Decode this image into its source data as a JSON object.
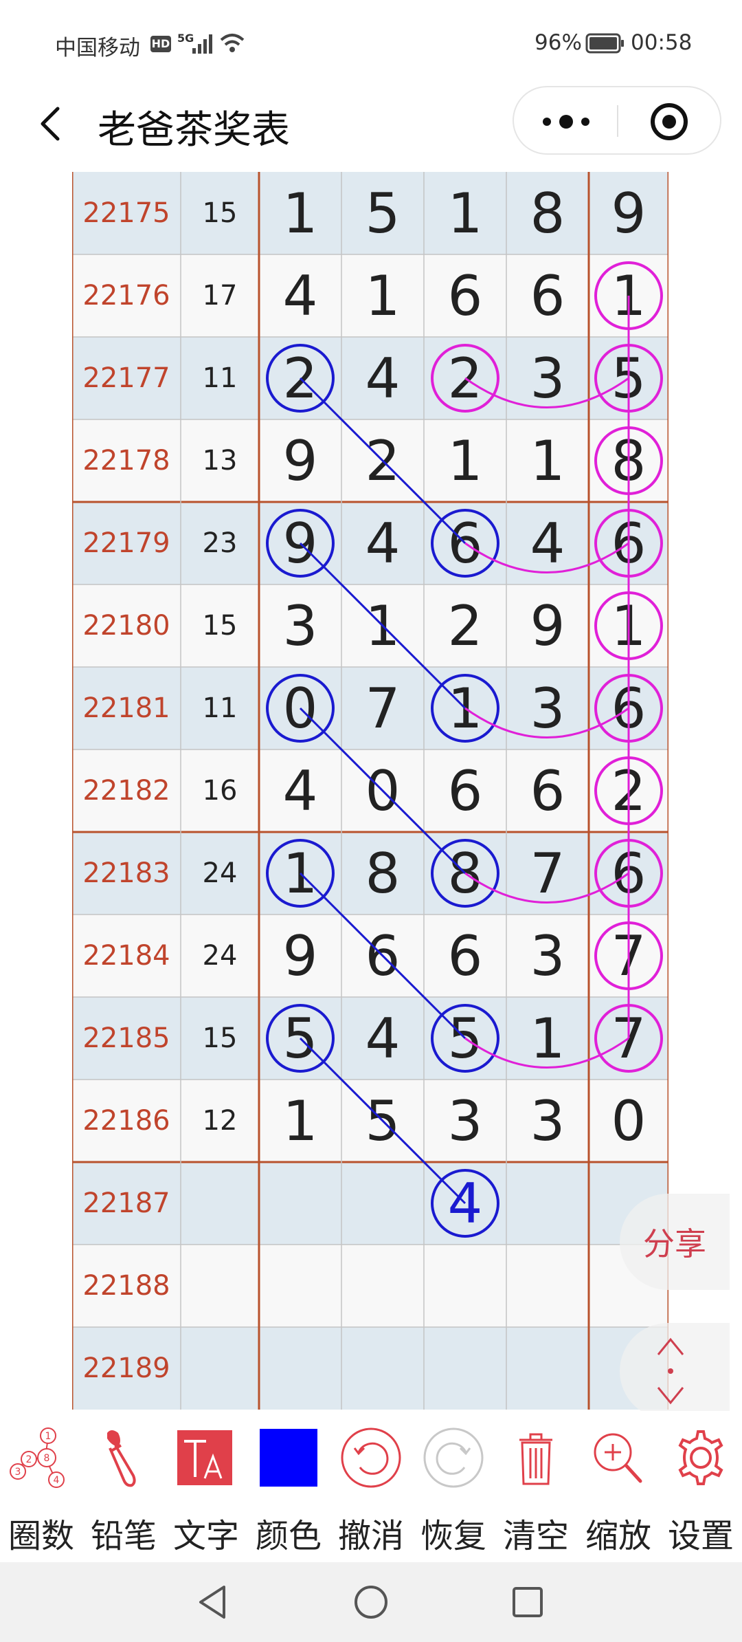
{
  "status_bar": {
    "carrier": "中国移动",
    "network_badges": [
      "HD",
      "5G"
    ],
    "battery_percent": "96%",
    "time": "00:58"
  },
  "header": {
    "title": "老爸茶奖表"
  },
  "table": {
    "rows": [
      {
        "issue": "22175",
        "sum": "15",
        "digits": [
          "1",
          "5",
          "1",
          "8",
          "9"
        ]
      },
      {
        "issue": "22176",
        "sum": "17",
        "digits": [
          "4",
          "1",
          "6",
          "6",
          "1"
        ]
      },
      {
        "issue": "22177",
        "sum": "11",
        "digits": [
          "2",
          "4",
          "2",
          "3",
          "5"
        ]
      },
      {
        "issue": "22178",
        "sum": "13",
        "digits": [
          "9",
          "2",
          "1",
          "1",
          "8"
        ]
      },
      {
        "issue": "22179",
        "sum": "23",
        "digits": [
          "9",
          "4",
          "6",
          "4",
          "6"
        ]
      },
      {
        "issue": "22180",
        "sum": "15",
        "digits": [
          "3",
          "1",
          "2",
          "9",
          "1"
        ]
      },
      {
        "issue": "22181",
        "sum": "11",
        "digits": [
          "0",
          "7",
          "1",
          "3",
          "6"
        ]
      },
      {
        "issue": "22182",
        "sum": "16",
        "digits": [
          "4",
          "0",
          "6",
          "6",
          "2"
        ]
      },
      {
        "issue": "22183",
        "sum": "24",
        "digits": [
          "1",
          "8",
          "8",
          "7",
          "6"
        ]
      },
      {
        "issue": "22184",
        "sum": "24",
        "digits": [
          "9",
          "6",
          "6",
          "3",
          "7"
        ]
      },
      {
        "issue": "22185",
        "sum": "15",
        "digits": [
          "5",
          "4",
          "5",
          "1",
          "7"
        ]
      },
      {
        "issue": "22186",
        "sum": "12",
        "digits": [
          "1",
          "5",
          "3",
          "3",
          "0"
        ]
      },
      {
        "issue": "22187",
        "sum": "",
        "digits": [
          "",
          "",
          "4",
          "",
          ""
        ]
      },
      {
        "issue": "22188",
        "sum": "",
        "digits": [
          "",
          "",
          "",
          "",
          ""
        ]
      },
      {
        "issue": "22189",
        "sum": "",
        "digits": [
          "",
          "",
          "",
          "",
          ""
        ]
      }
    ]
  },
  "annotations": {
    "blue_color": "#1a1ad0",
    "magenta_color": "#e020d8"
  },
  "floating": {
    "share_label": "分享"
  },
  "toolbar": {
    "items": [
      {
        "label": "圈数",
        "icon": "circle-numbers-icon"
      },
      {
        "label": "铅笔",
        "icon": "pencil-brush-icon"
      },
      {
        "label": "文字",
        "icon": "text-icon"
      },
      {
        "label": "颜色",
        "icon": "color-swatch-icon",
        "current_color": "#0000ff"
      },
      {
        "label": "撤消",
        "icon": "undo-icon"
      },
      {
        "label": "恢复",
        "icon": "redo-icon"
      },
      {
        "label": "清空",
        "icon": "trash-icon"
      },
      {
        "label": "缩放",
        "icon": "zoom-in-icon"
      },
      {
        "label": "设置",
        "icon": "gear-icon"
      }
    ],
    "accent_color": "#e0404a"
  }
}
